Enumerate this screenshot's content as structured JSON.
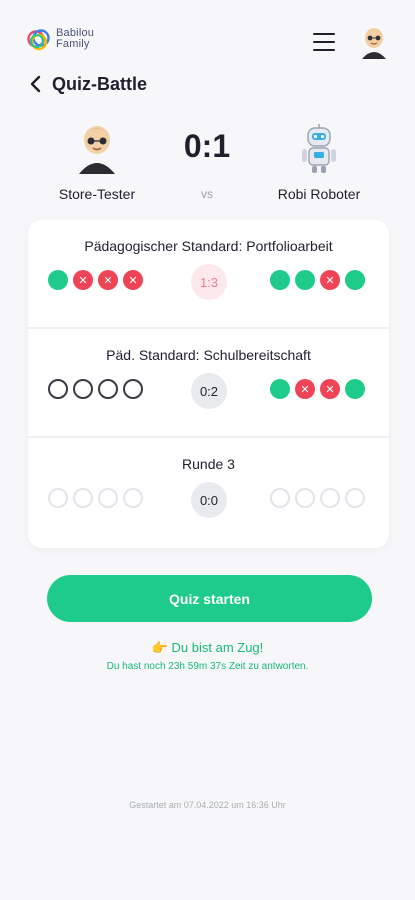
{
  "app": {
    "logo_line1": "Babilou",
    "logo_line2": "Family",
    "title": "Quiz-Battle",
    "colors": {
      "accent": "#1ecb8a",
      "wrong": "#ee4455",
      "text": "#1f1f2e"
    }
  },
  "match": {
    "player_left": "Store-Tester",
    "player_right": "Robi Roboter",
    "score": "0:1",
    "vs": "vs"
  },
  "rounds": [
    {
      "title": "Pädagogischer Standard: Portfolioarbeit",
      "score": "1:3",
      "left": [
        "correct",
        "wrong",
        "wrong",
        "wrong"
      ],
      "right": [
        "correct",
        "correct",
        "wrong",
        "correct"
      ]
    },
    {
      "title": "Päd. Standard: Schulbereitschaft",
      "score": "0:2",
      "left": [
        "empty",
        "empty",
        "empty",
        "empty"
      ],
      "right": [
        "correct",
        "wrong",
        "wrong",
        "correct"
      ]
    },
    {
      "title": "Runde 3",
      "score": "0:0",
      "left": [
        "pending",
        "pending",
        "pending",
        "pending"
      ],
      "right": [
        "pending",
        "pending",
        "pending",
        "pending"
      ]
    }
  ],
  "actions": {
    "start_label": "Quiz starten",
    "turn_icon": "👉",
    "turn_text": "Du bist am Zug!",
    "time_left": "Du hast noch 23h 59m 37s Zeit zu antworten.",
    "started": "Gestartet am 07.04.2022 um 16:36 Uhr"
  }
}
